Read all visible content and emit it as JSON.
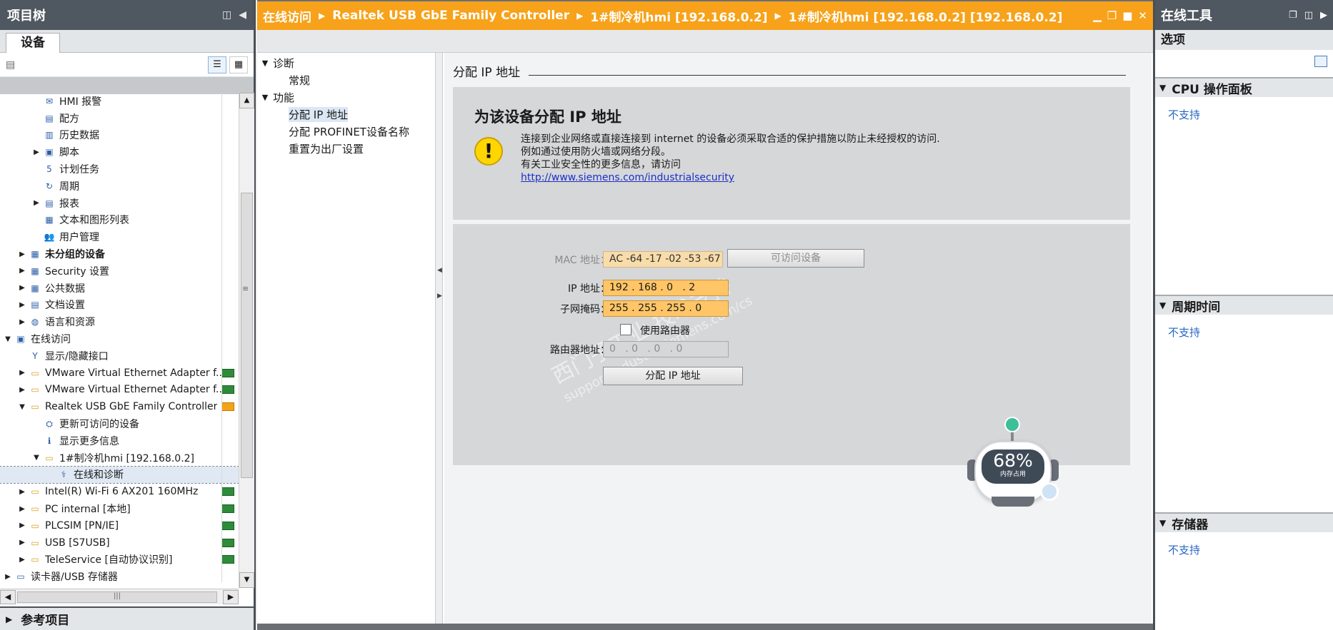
{
  "left_panel": {
    "title": "项目树",
    "tab": "设备",
    "tree": [
      {
        "label": "HMI 报警",
        "level": 3,
        "arrow": "",
        "icon": "envelope-icon"
      },
      {
        "label": "配方",
        "level": 3,
        "arrow": "",
        "icon": "recipe-icon"
      },
      {
        "label": "历史数据",
        "level": 3,
        "arrow": "",
        "icon": "archive-icon"
      },
      {
        "label": "脚本",
        "level": 3,
        "arrow": "▶",
        "icon": "script-icon"
      },
      {
        "label": "计划任务",
        "level": 3,
        "arrow": "",
        "icon": "scheduler-icon"
      },
      {
        "label": "周期",
        "level": 3,
        "arrow": "",
        "icon": "cycle-icon"
      },
      {
        "label": "报表",
        "level": 3,
        "arrow": "▶",
        "icon": "report-icon"
      },
      {
        "label": "文本和图形列表",
        "level": 3,
        "arrow": "",
        "icon": "text-list-icon"
      },
      {
        "label": "用户管理",
        "level": 3,
        "arrow": "",
        "icon": "users-icon"
      },
      {
        "label": "未分组的设备",
        "level": 2,
        "arrow": "▶",
        "icon": "device-group-icon",
        "bold": true
      },
      {
        "label": "Security 设置",
        "level": 2,
        "arrow": "▶",
        "icon": "security-icon"
      },
      {
        "label": "公共数据",
        "level": 2,
        "arrow": "▶",
        "icon": "common-data-icon"
      },
      {
        "label": "文档设置",
        "level": 2,
        "arrow": "▶",
        "icon": "doc-settings-icon"
      },
      {
        "label": "语言和资源",
        "level": 2,
        "arrow": "▶",
        "icon": "languages-icon"
      },
      {
        "label": "在线访问",
        "level": 1,
        "arrow": "▼",
        "icon": "online-access-icon"
      },
      {
        "label": "显示/隐藏接口",
        "level": 2,
        "arrow": "",
        "icon": "interface-toggle-icon"
      },
      {
        "label": "VMware Virtual Ethernet Adapter f...",
        "level": 2,
        "arrow": "▶",
        "icon": "folder-icon",
        "status": "green"
      },
      {
        "label": "VMware Virtual Ethernet Adapter f...",
        "level": 2,
        "arrow": "▶",
        "icon": "folder-icon",
        "status": "green"
      },
      {
        "label": "Realtek USB GbE Family Controller",
        "level": 2,
        "arrow": "▼",
        "icon": "folder-icon",
        "status": "orange"
      },
      {
        "label": "更新可访问的设备",
        "level": 3,
        "arrow": "",
        "icon": "update-devices-icon"
      },
      {
        "label": "显示更多信息",
        "level": 3,
        "arrow": "",
        "icon": "more-info-icon"
      },
      {
        "label": "1#制冷机hmi [192.168.0.2]",
        "level": 3,
        "arrow": "▼",
        "icon": "folder-icon"
      },
      {
        "label": "在线和诊断",
        "level": 4,
        "arrow": "",
        "icon": "diagnostics-icon",
        "selected": true
      },
      {
        "label": "Intel(R) Wi-Fi 6 AX201 160MHz",
        "level": 2,
        "arrow": "▶",
        "icon": "folder-icon",
        "status": "green"
      },
      {
        "label": "PC internal [本地]",
        "level": 2,
        "arrow": "▶",
        "icon": "folder-icon",
        "status": "green"
      },
      {
        "label": "PLCSIM [PN/IE]",
        "level": 2,
        "arrow": "▶",
        "icon": "folder-icon",
        "status": "green"
      },
      {
        "label": "USB [S7USB]",
        "level": 2,
        "arrow": "▶",
        "icon": "folder-icon",
        "status": "green"
      },
      {
        "label": "TeleService [自动协议识别]",
        "level": 2,
        "arrow": "▶",
        "icon": "folder-icon",
        "status": "green"
      },
      {
        "label": "读卡器/USB 存储器",
        "level": 1,
        "arrow": "▶",
        "icon": "card-reader-icon"
      }
    ],
    "reference_projects": "参考项目"
  },
  "editor": {
    "breadcrumb": [
      "在线访问",
      "Realtek USB GbE Family Controller",
      "1#制冷机hmi [192.168.0.2]",
      "1#制冷机hmi [192.168.0.2] [192.168.0.2]"
    ],
    "nav": {
      "diagnostics": "诊断",
      "general": "常规",
      "functions": "功能",
      "assign_ip": "分配 IP 地址",
      "assign_profinet": "分配 PROFINET设备名称",
      "reset_factory": "重置为出厂设置"
    },
    "section_title": "分配 IP 地址",
    "security": {
      "heading": "为该设备分配 IP 地址",
      "line1": "连接到企业网络或直接连接到 internet 的设备必须采取合适的保护措施以防止未经授权的访问.",
      "line2": "例如通过使用防火墙或网络分段。",
      "line3": "有关工业安全性的更多信息，请访问",
      "link": "http://www.siemens.com/industrialsecurity"
    },
    "form": {
      "mac_label": "MAC 地址：",
      "mac_value": "AC -64 -17 -02 -53 -67",
      "accessible_devices_button": "可访问设备",
      "ip_label": "IP 地址：",
      "ip_value": "192 . 168 . 0   . 2",
      "subnet_label": "子网掩码：",
      "subnet_value": "255 . 255 . 255 . 0",
      "use_router_label": "使用路由器",
      "use_router_checked": false,
      "router_label": "路由器地址：",
      "router_value": "0   . 0   . 0   . 0",
      "assign_button": "分配 IP 地址"
    },
    "watermark": {
      "line1": "西门子工业 技术支持",
      "line2": "support.industry.siemens.com/cs"
    },
    "memory_widget": {
      "percent": "68%",
      "label": "内存占用"
    }
  },
  "right_panel": {
    "title": "在线工具",
    "options": "选项",
    "sections": [
      {
        "title": "CPU 操作面板",
        "status": "不支持"
      },
      {
        "title": "周期时间",
        "status": "不支持"
      },
      {
        "title": "存储器",
        "status": "不支持"
      }
    ]
  },
  "colors": {
    "accent_orange": "#f7a21a",
    "field_orange": "#ffc567",
    "header_gray": "#4f5760",
    "link_blue": "#1b2fc9"
  }
}
